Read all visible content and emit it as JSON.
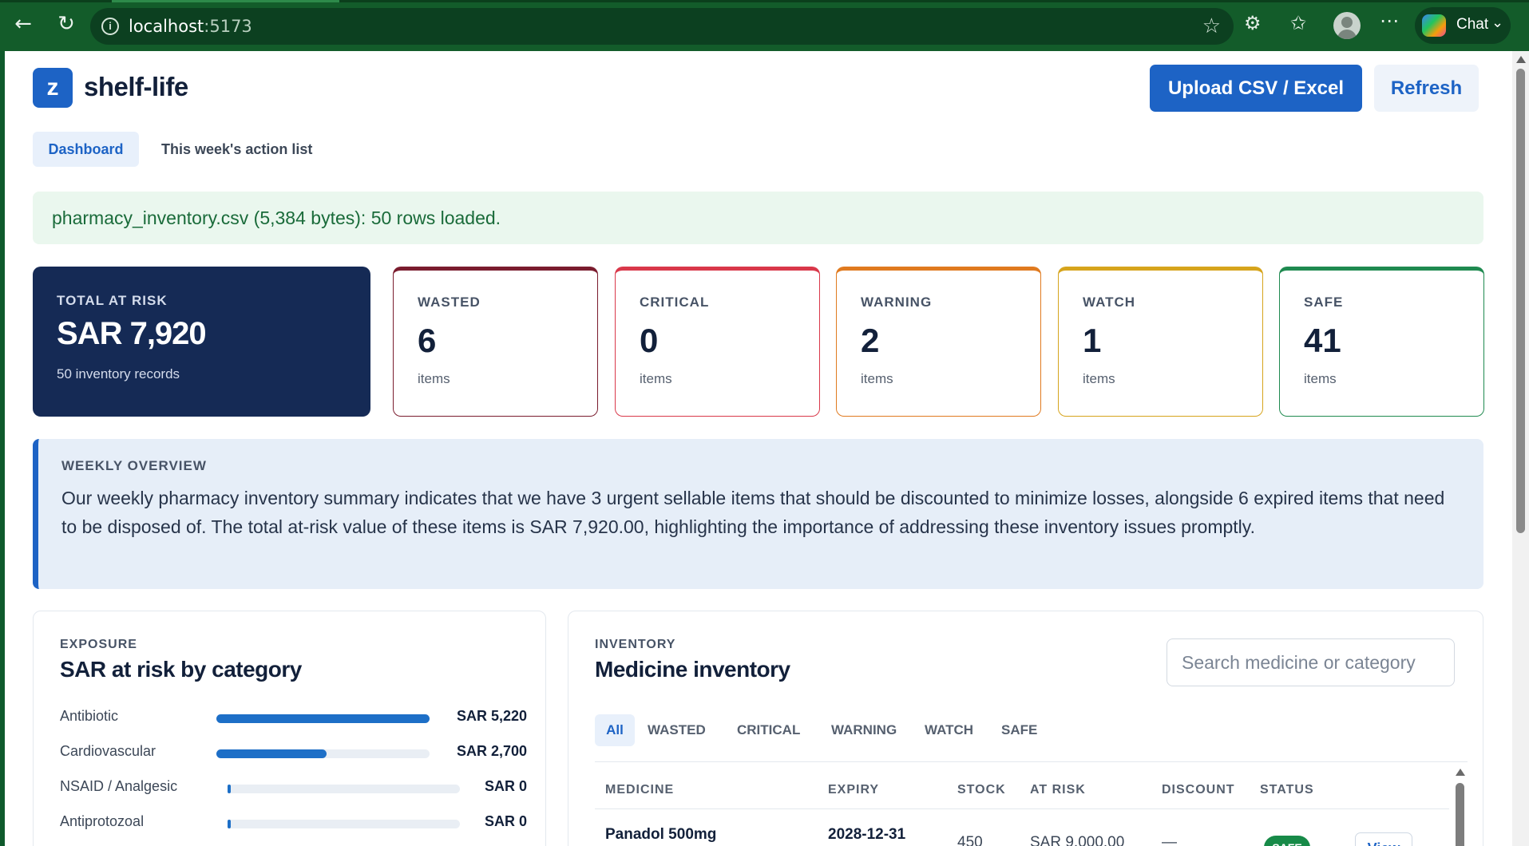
{
  "browser": {
    "url_host": "localhost",
    "url_port": ":5173",
    "chat_label": "Chat"
  },
  "header": {
    "logo_letter": "z",
    "app_name": "shelf-life",
    "upload_label": "Upload CSV / Excel",
    "refresh_label": "Refresh"
  },
  "tabs": {
    "dashboard": "Dashboard",
    "action_list": "This week's action list"
  },
  "notice": "pharmacy_inventory.csv (5,384 bytes): 50 rows loaded.",
  "total_card": {
    "label": "TOTAL AT RISK",
    "value": "SAR 7,920",
    "sub": "50 inventory records"
  },
  "stat_cards": [
    {
      "label": "WASTED",
      "value": "6",
      "sub": "items",
      "color": "#7a1c2e"
    },
    {
      "label": "CRITICAL",
      "value": "0",
      "sub": "items",
      "color": "#d9384a"
    },
    {
      "label": "WARNING",
      "value": "2",
      "sub": "items",
      "color": "#e07a1f"
    },
    {
      "label": "WATCH",
      "value": "1",
      "sub": "items",
      "color": "#d6a41c"
    },
    {
      "label": "SAFE",
      "value": "41",
      "sub": "items",
      "color": "#1f8a50"
    }
  ],
  "overview": {
    "label": "WEEKLY OVERVIEW",
    "text": "Our weekly pharmacy inventory summary indicates that we have 3 urgent sellable items that should be discounted to minimize losses, alongside 6 expired items that need to be disposed of. The total at-risk value of these items is SAR 7,920.00, highlighting the importance of addressing these inventory issues promptly."
  },
  "exposure": {
    "eyebrow": "EXPOSURE",
    "title": "SAR at risk by category",
    "categories": [
      {
        "name": "Antibiotic",
        "value": "SAR 5,220",
        "fraction": 1.0
      },
      {
        "name": "Cardiovascular",
        "value": "SAR 2,700",
        "fraction": 0.517
      },
      {
        "name": "NSAID / Analgesic",
        "value": "SAR 0",
        "fraction": 0.0
      },
      {
        "name": "Antiprotozoal",
        "value": "SAR 0",
        "fraction": 0.0
      }
    ]
  },
  "inventory": {
    "eyebrow": "INVENTORY",
    "title": "Medicine inventory",
    "search_placeholder": "Search medicine or category",
    "filters": [
      "All",
      "WASTED",
      "CRITICAL",
      "WARNING",
      "WATCH",
      "SAFE"
    ],
    "columns": [
      "MEDICINE",
      "EXPIRY",
      "STOCK",
      "AT RISK",
      "DISCOUNT",
      "STATUS"
    ],
    "rows": [
      {
        "medicine": "Panadol 500mg",
        "expiry": "2028-12-31",
        "stock": "450",
        "at_risk": "SAR 9,000.00",
        "discount": "—",
        "status": "SAFE",
        "action": "View"
      }
    ]
  }
}
